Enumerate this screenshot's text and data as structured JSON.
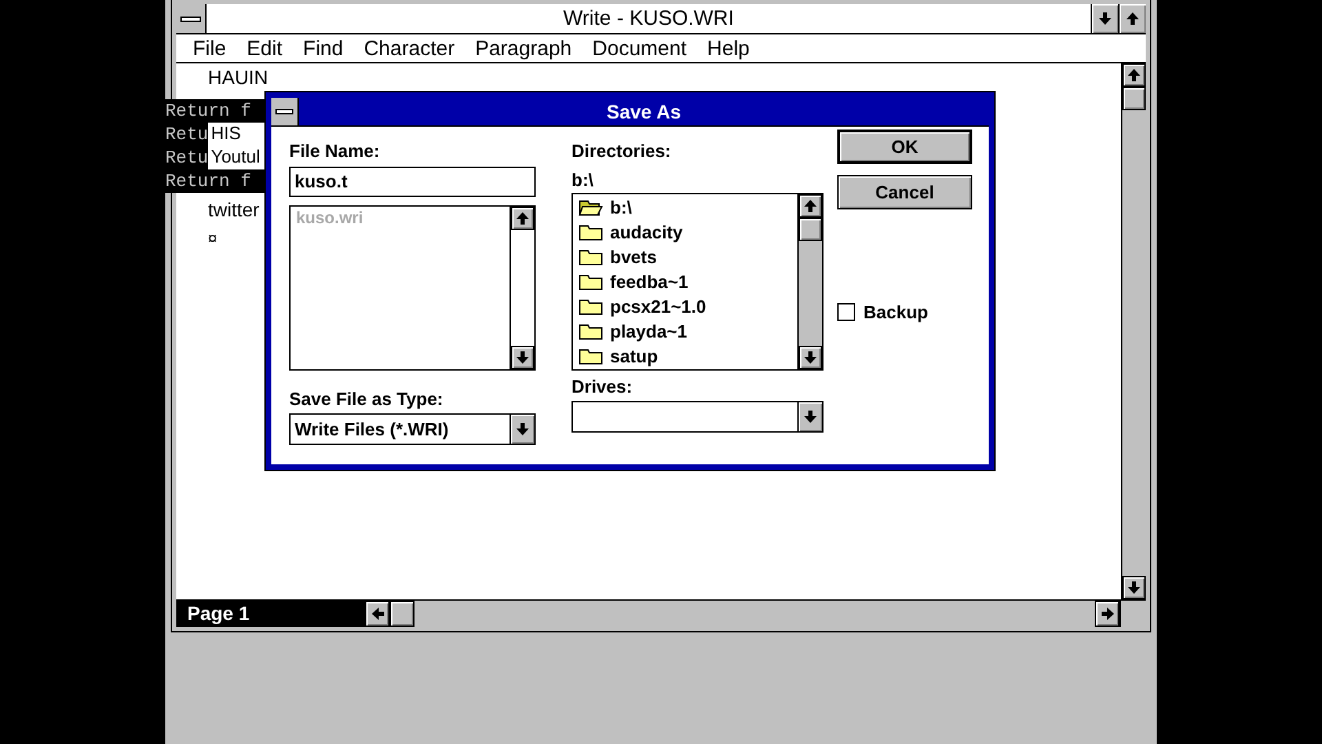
{
  "window": {
    "title": "Write - KUSO.WRI"
  },
  "menu": [
    "File",
    "Edit",
    "Find",
    "Character",
    "Paragraph",
    "Document",
    "Help"
  ],
  "document": {
    "lines": [
      "HAUIN",
      "twitter",
      "¤"
    ]
  },
  "console": {
    "lines": [
      {
        "text": "Return f"
      },
      {
        "text": "Retu",
        "overlay": "HIS"
      },
      {
        "text": "Retu",
        "overlay": "Youtul"
      },
      {
        "text": "Return f"
      }
    ]
  },
  "status": {
    "page": "Page 1"
  },
  "dialog": {
    "title": "Save As",
    "file_name": {
      "label": "File Name:",
      "value": "kuso.t"
    },
    "files": [
      {
        "name": "kuso.wri",
        "disabled": true
      }
    ],
    "type": {
      "label": "Save File as Type:",
      "value": "Write Files (*.WRI)"
    },
    "directories": {
      "label": "Directories:",
      "path": "b:\\",
      "items": [
        {
          "name": "b:\\",
          "kind": "open"
        },
        {
          "name": "audacity",
          "kind": "folder"
        },
        {
          "name": "bvets",
          "kind": "folder"
        },
        {
          "name": "feedba~1",
          "kind": "folder"
        },
        {
          "name": "pcsx21~1.0",
          "kind": "folder"
        },
        {
          "name": "playda~1",
          "kind": "folder"
        },
        {
          "name": "satup",
          "kind": "folder"
        }
      ]
    },
    "drives": {
      "label": "Drives:"
    },
    "buttons": [
      {
        "label": "OK",
        "default": true
      },
      {
        "label": "Cancel",
        "default": false
      }
    ],
    "backup": {
      "label": "Backup",
      "checked": false
    }
  }
}
